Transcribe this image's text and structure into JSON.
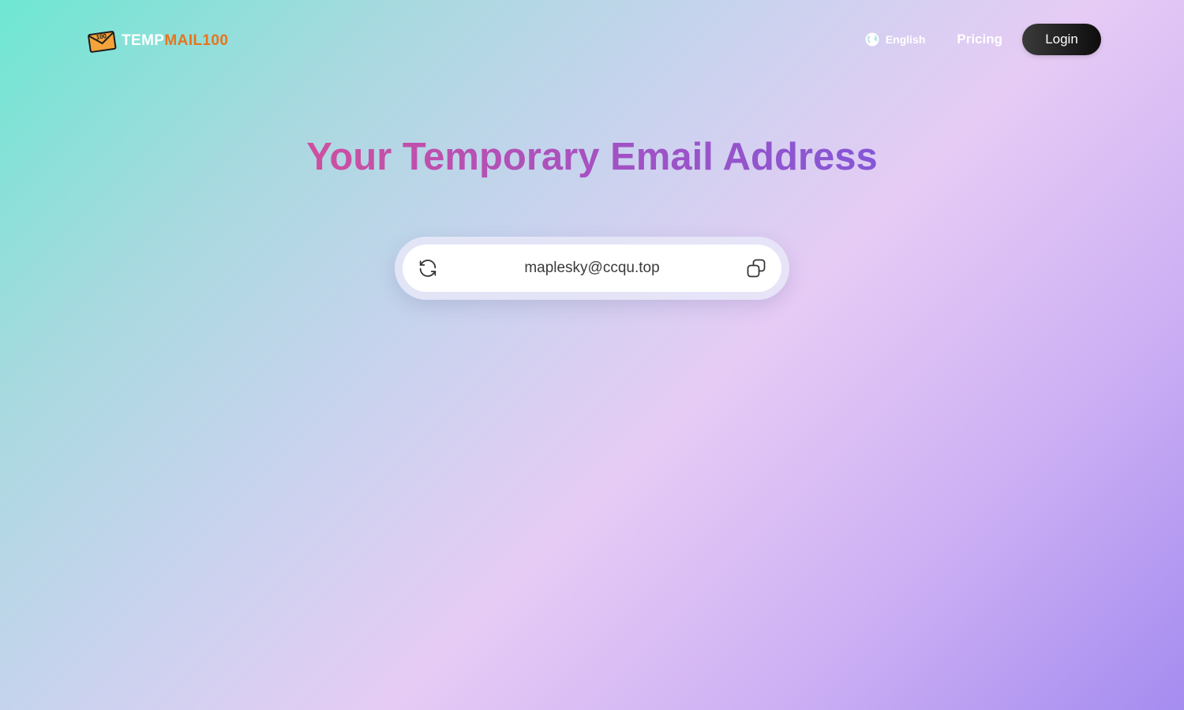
{
  "header": {
    "logo": {
      "text_part1": "TEMP",
      "text_part2": "MAIL100",
      "icon": "envelope-logo-icon",
      "badge_text": "100"
    },
    "nav": {
      "language": {
        "icon": "globe-icon",
        "label": "English"
      },
      "pricing_label": "Pricing",
      "login_label": "Login"
    }
  },
  "hero": {
    "title": "Your Temporary Email Address"
  },
  "email_box": {
    "address": "maplesky@ccqu.top",
    "refresh_icon": "refresh-icon",
    "copy_icon": "copy-icon"
  },
  "colors": {
    "logo_accent": "#e8731c",
    "title_gradient_start": "#cf4f9f",
    "title_gradient_end": "#8457d6",
    "login_button": "#1a1a1a"
  }
}
